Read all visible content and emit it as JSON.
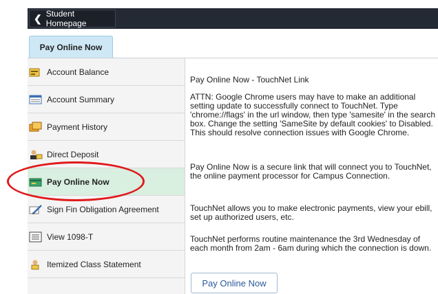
{
  "topbar": {
    "back_label": "Student Homepage"
  },
  "tab": {
    "label": "Pay Online Now"
  },
  "sidebar": {
    "items": [
      {
        "label": "Account Balance",
        "icon": "account-balance-icon"
      },
      {
        "label": "Account Summary",
        "icon": "account-summary-icon"
      },
      {
        "label": "Payment History",
        "icon": "payment-history-icon"
      },
      {
        "label": "Direct Deposit",
        "icon": "direct-deposit-icon"
      },
      {
        "label": "Pay Online Now",
        "icon": "pay-online-icon",
        "active": true
      },
      {
        "label": "Sign Fin Obligation Agreement",
        "icon": "sign-agreement-icon"
      },
      {
        "label": "View 1098-T",
        "icon": "tax-form-icon"
      },
      {
        "label": "Itemized Class Statement",
        "icon": "class-statement-icon"
      }
    ]
  },
  "content": {
    "title": "Pay Online Now - TouchNet Link",
    "p1": "ATTN: Google Chrome users may have to make an additional setting update to successfully connect to TouchNet. Type 'chrome://flags' in the url window, then type 'samesite' in the search box. Change the setting 'SameSite by default cookies' to Disabled. This should resolve connection issues with Google Chrome.",
    "p2": "Pay Online Now is a secure link that will connect you to TouchNet, the online payment processor for Campus Connection.",
    "p3": "TouchNet allows you to make electronic payments, view your ebill, set up authorized users, etc.",
    "p4": "TouchNet performs routine maintenance the 3rd Wednesday of each month from 2am - 6am during which the connection is down.",
    "button_label": "Pay Online Now"
  },
  "colors": {
    "topbar": "#242a33",
    "tab_active": "#cfe8f5",
    "nav_active": "#d9efe0",
    "annotation": "#e0191b",
    "link": "#2a5a9a"
  }
}
